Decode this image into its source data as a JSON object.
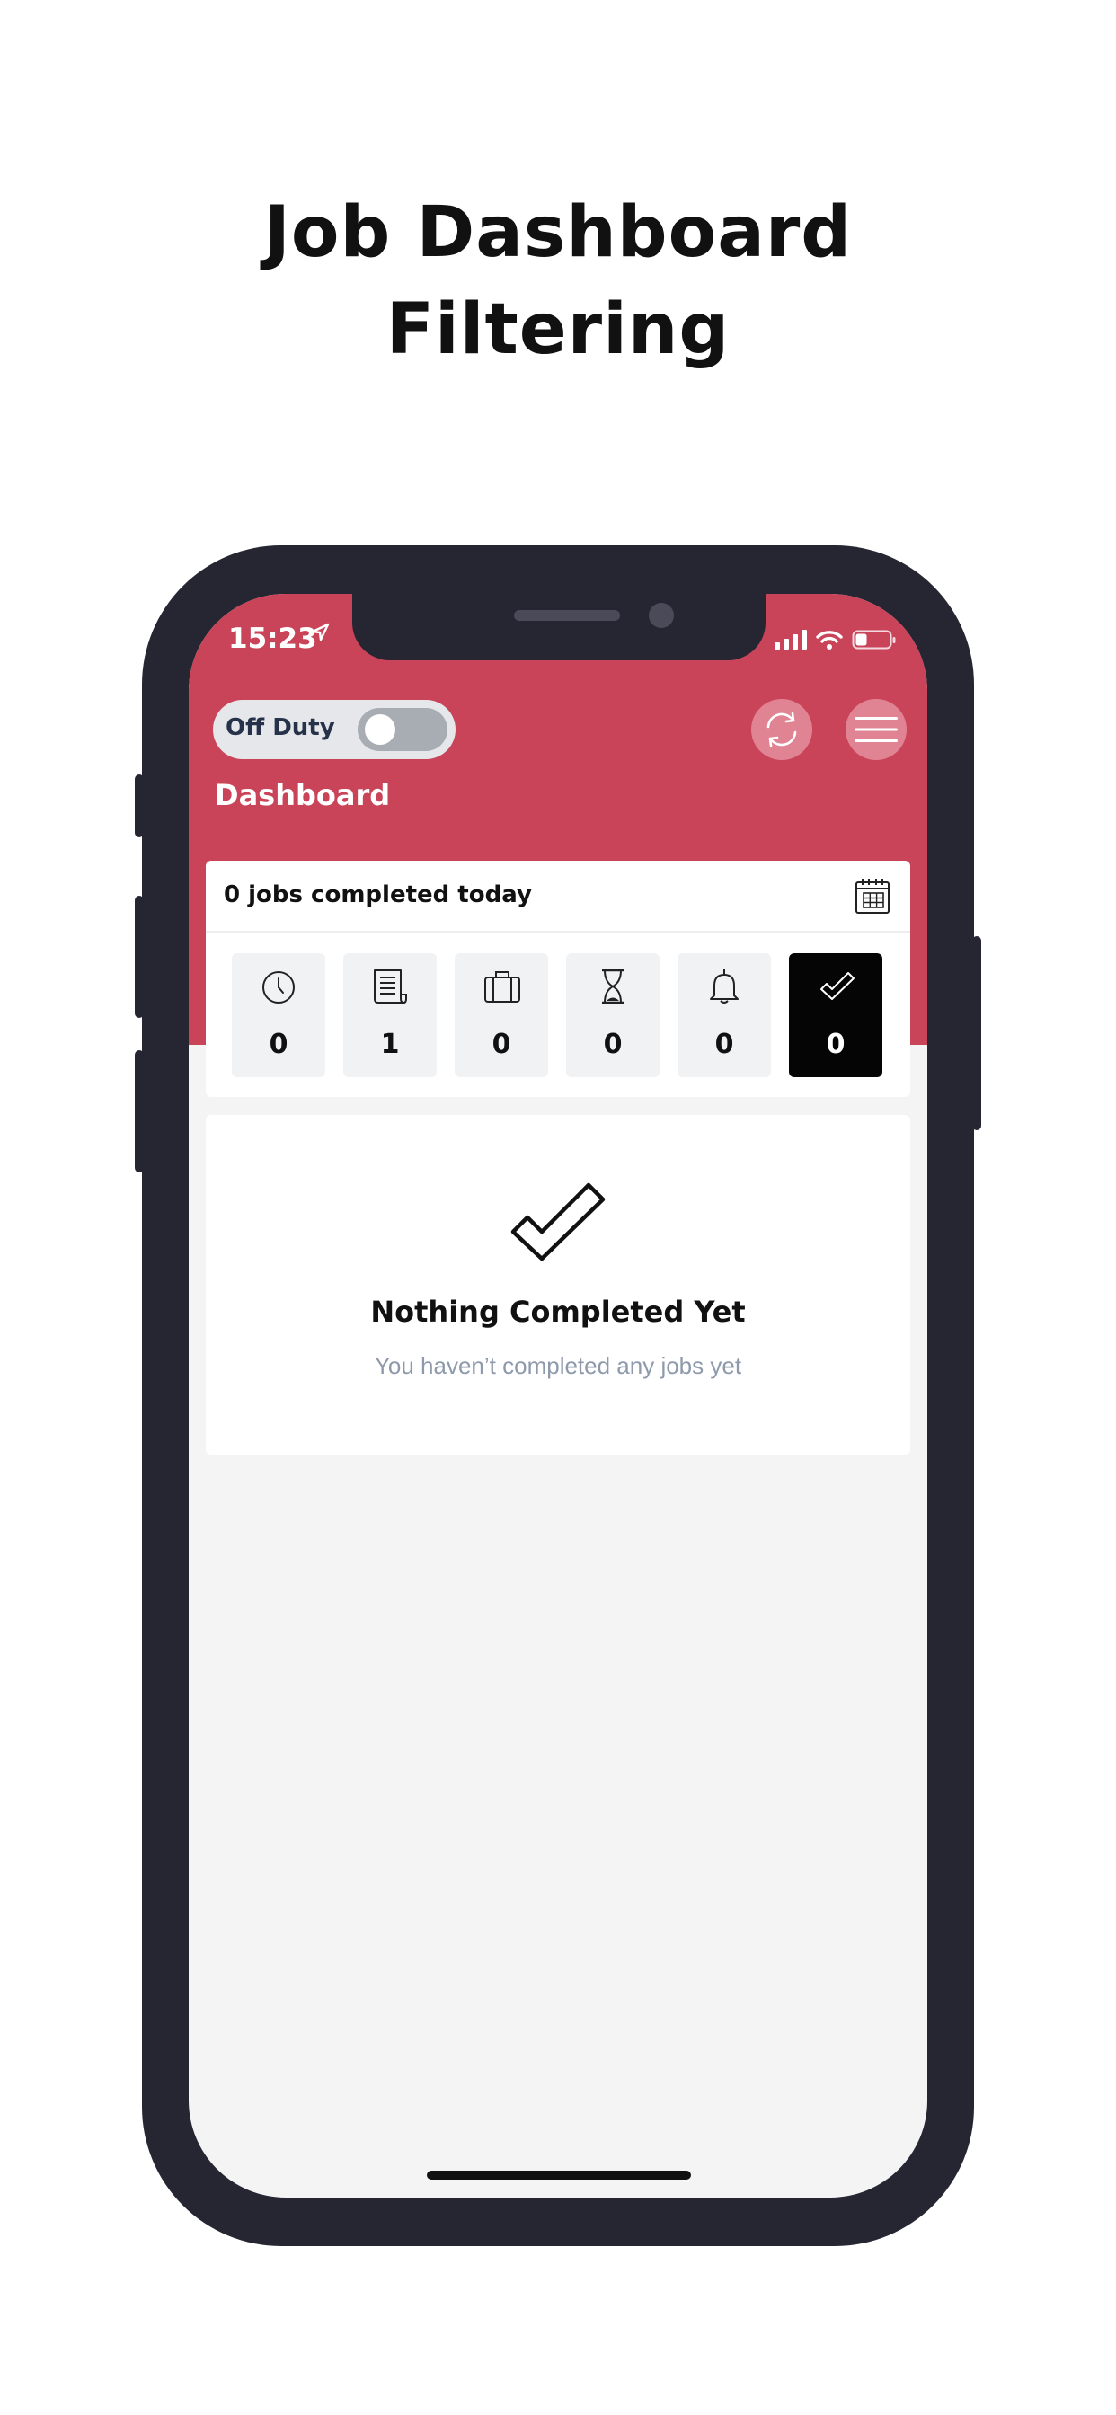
{
  "headline": {
    "line1": "Job Dashboard",
    "line2": "Filtering"
  },
  "status_bar": {
    "time": "15:23",
    "location_icon": "location-arrow-icon",
    "signal_icon": "signal-bars-icon",
    "wifi_icon": "wifi-icon",
    "battery_icon": "battery-low-icon"
  },
  "header": {
    "duty_label": "Off Duty",
    "duty_on": false,
    "sync_icon": "sync-icon",
    "menu_icon": "hamburger-menu-icon",
    "title": "Dashboard"
  },
  "summary": {
    "text": "0 jobs completed today",
    "calendar_icon": "calendar-icon"
  },
  "filters": [
    {
      "icon": "clock-icon",
      "count": "0",
      "active": false
    },
    {
      "icon": "document-list-icon",
      "count": "1",
      "active": false
    },
    {
      "icon": "briefcase-icon",
      "count": "0",
      "active": false
    },
    {
      "icon": "hourglass-icon",
      "count": "0",
      "active": false
    },
    {
      "icon": "bell-icon",
      "count": "0",
      "active": false
    },
    {
      "icon": "checkmark-icon",
      "count": "0",
      "active": true
    }
  ],
  "empty_state": {
    "icon": "checkmark-icon",
    "title": "Nothing Completed Yet",
    "subtitle": "You haven’t completed any jobs yet"
  },
  "colors": {
    "brand": "#c94459",
    "frame": "#262633",
    "screen_bg": "#f4f4f5",
    "muted_text": "#8e9aab"
  }
}
